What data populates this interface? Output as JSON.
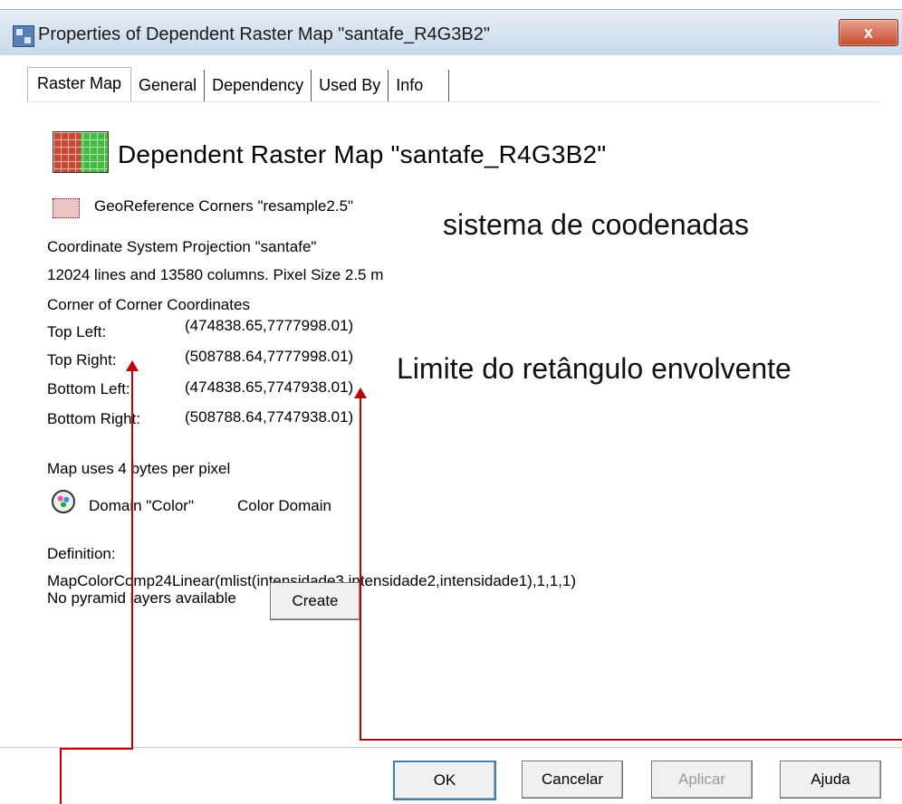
{
  "window": {
    "title": "Properties of Dependent Raster Map \"santafe_R4G3B2\"",
    "close_label": "x"
  },
  "tabs": [
    {
      "label": "Raster Map",
      "active": true
    },
    {
      "label": "General",
      "active": false
    },
    {
      "label": "Dependency",
      "active": false
    },
    {
      "label": "Used By",
      "active": false
    },
    {
      "label": "Info",
      "active": false
    }
  ],
  "content": {
    "heading": "Dependent Raster Map \"santafe_R4G3B2\"",
    "georef": "GeoReference Corners \"resample2.5\"",
    "coordsys": "Coordinate System Projection \"santafe\"",
    "dims": "12024 lines and 13580 columns.  Pixel Size 2.5 m",
    "corner_title": "Corner of Corner Coordinates",
    "corners": [
      {
        "label": "Top Left:",
        "value": "(474838.65,7777998.01)"
      },
      {
        "label": "Top Right:",
        "value": "(508788.64,7777998.01)"
      },
      {
        "label": "Bottom Left:",
        "value": "(474838.65,7747938.01)"
      },
      {
        "label": "Bottom Right:",
        "value": "(508788.64,7747938.01)"
      }
    ],
    "bytes": "Map uses 4 bytes per pixel",
    "domain": "Domain \"Color\"",
    "domain_type": "Color Domain",
    "definition_label": "Definition:",
    "definition": "MapColorComp24Linear(mlist(intensidade3,intensidade2,intensidade1),1,1,1)",
    "pyramid": "No pyramid layers available",
    "create_label": "Create"
  },
  "annotations": {
    "coords_note": "sistema de coodenadas",
    "limit_note": "Limite do retângulo envolvente"
  },
  "buttons": {
    "ok": "OK",
    "cancel": "Cancelar",
    "apply": "Aplicar",
    "help": "Ajuda"
  },
  "colors": {
    "annotation_arrow": "#c00000"
  }
}
